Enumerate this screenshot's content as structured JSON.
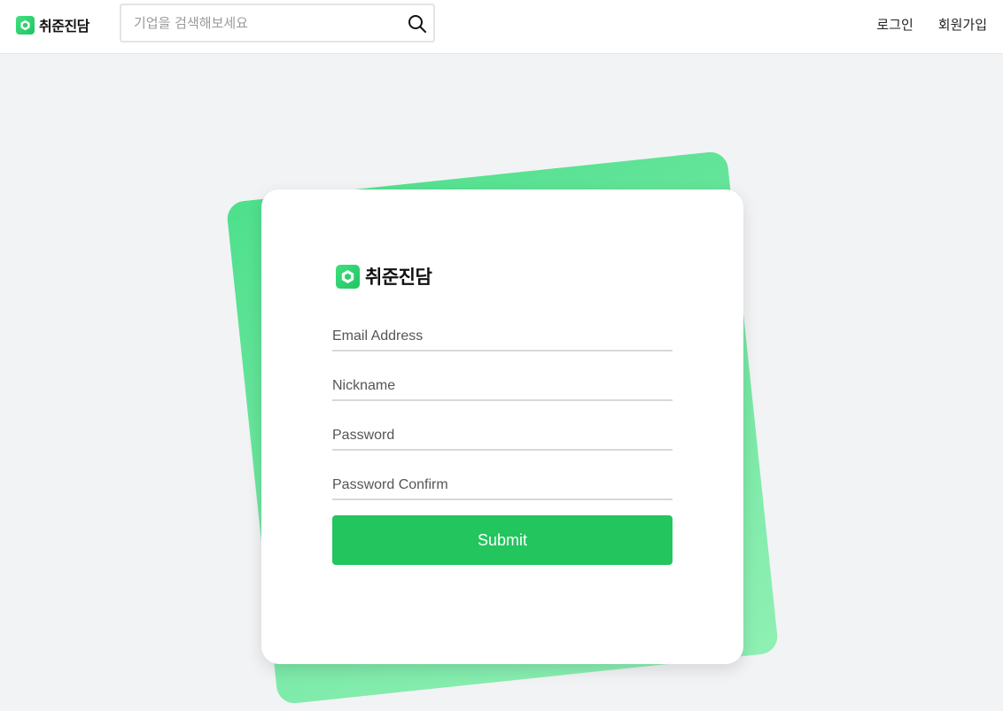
{
  "header": {
    "brand_name": "취준진담",
    "search_placeholder": "기업을 검색해보세요",
    "nav": {
      "login": "로그인",
      "signup": "회원가입"
    }
  },
  "card": {
    "brand_name": "취준진담",
    "fields": {
      "email_placeholder": "Email Address",
      "nickname_placeholder": "Nickname",
      "password_placeholder": "Password",
      "password_confirm_placeholder": "Password Confirm"
    },
    "submit_label": "Submit"
  },
  "colors": {
    "brand_green": "#22c55e",
    "background": "#f2f3f5"
  },
  "icons": {
    "logo": "hexagon-logo-icon",
    "search": "search-icon"
  }
}
